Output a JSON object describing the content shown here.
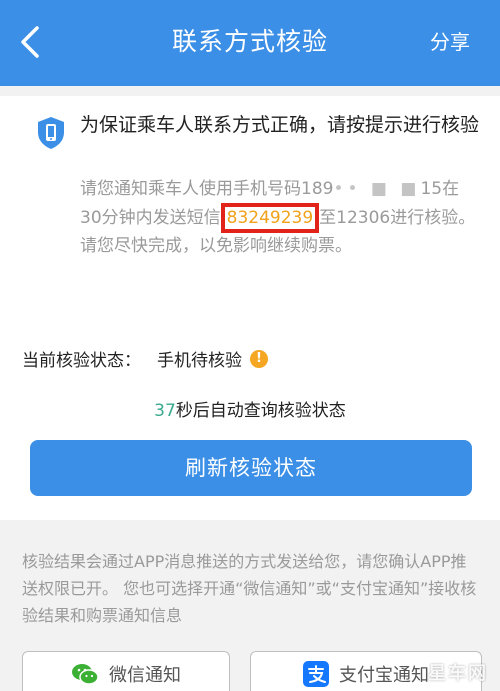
{
  "header": {
    "title": "联系方式核验",
    "share_label": "分享",
    "color": "#3b8fe6"
  },
  "notice": {
    "text": "为保证乘车人联系方式正确，请按提示进行核验",
    "icon": "shield-phone-icon"
  },
  "instruction": {
    "part1": "请您通知乘车人使用手机号码189",
    "masked": "•• ■ ■",
    "part2": "15在30分钟内发送短信",
    "code": "83249239",
    "part3": "至12306进行核验。请您尽快完成，以免影响继续购票。"
  },
  "status": {
    "label": "当前核验状态：",
    "value": "手机待核验",
    "icon": "warning-icon"
  },
  "countdown": {
    "seconds": "37",
    "text": "秒后自动查询核验状态"
  },
  "refresh_button": "刷新核验状态",
  "info_text": "核验结果会通过APP消息推送的方式发送给您，请您确认APP推送权限已开。 您也可选择开通“微信通知”或“支付宝通知”接收核验结果和购票通知信息",
  "options": {
    "wechat": "微信通知",
    "alipay": "支付宝通知"
  },
  "watermark": "星车网",
  "colors": {
    "accent": "#3b8fe6",
    "code_text": "#f0a21a",
    "code_border": "#e2231a",
    "countdown": "#3aa98c",
    "warning": "#f5a623",
    "wechat": "#3cb034",
    "alipay": "#1677ff"
  }
}
